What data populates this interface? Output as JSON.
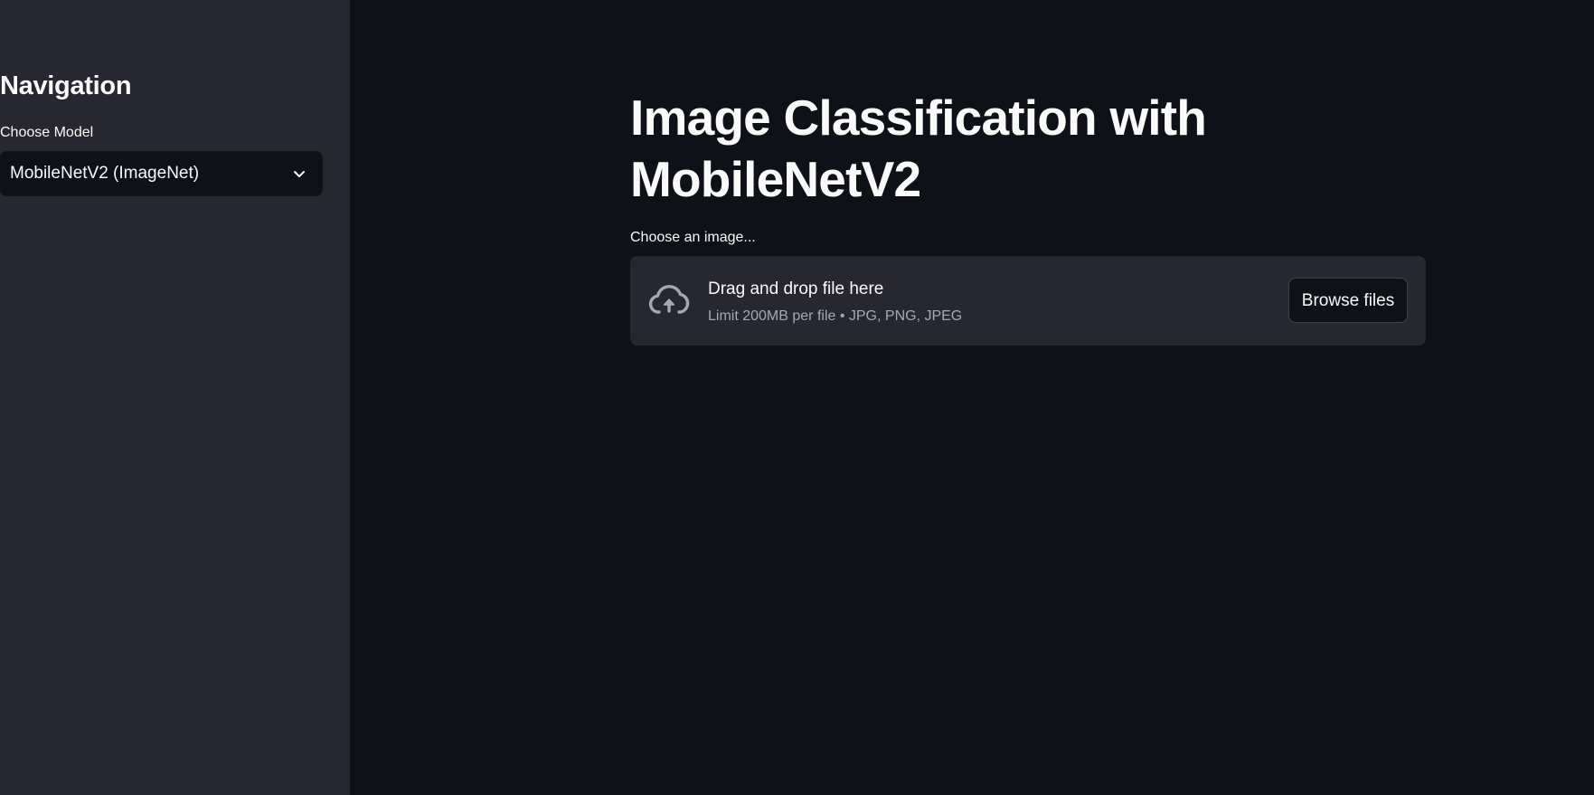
{
  "sidebar": {
    "title": "Navigation",
    "model_select": {
      "label": "Choose Model",
      "selected": "MobileNetV2 (ImageNet)",
      "icon": "chevron-down-icon"
    }
  },
  "main": {
    "title": "Image Classification with MobileNetV2",
    "uploader": {
      "label": "Choose an image...",
      "drop_title": "Drag and drop file here",
      "drop_subtitle": "Limit 200MB per file • JPG, PNG, JPEG",
      "browse_label": "Browse files",
      "icon": "cloud-upload-icon"
    }
  },
  "colors": {
    "background": "#0e1117",
    "sidebar_background": "#262730",
    "text": "#fafafa",
    "muted_text": "#a3a8b8"
  }
}
